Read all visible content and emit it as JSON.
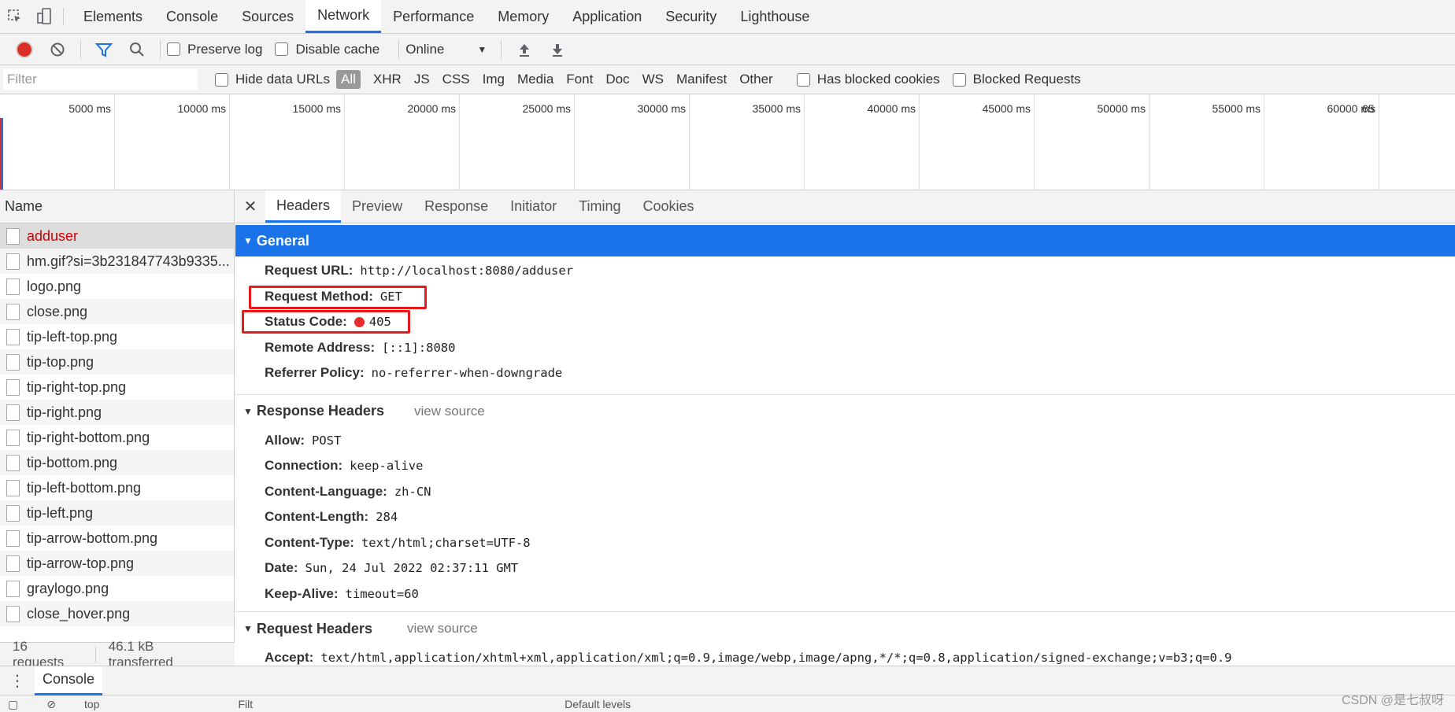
{
  "main_tabs": [
    "Elements",
    "Console",
    "Sources",
    "Network",
    "Performance",
    "Memory",
    "Application",
    "Security",
    "Lighthouse"
  ],
  "toolbar": {
    "preserve_log": "Preserve log",
    "disable_cache": "Disable cache",
    "throttling": "Online"
  },
  "filter": {
    "placeholder": "Filter",
    "hide_data_urls": "Hide data URLs",
    "types": [
      "All",
      "XHR",
      "JS",
      "CSS",
      "Img",
      "Media",
      "Font",
      "Doc",
      "WS",
      "Manifest",
      "Other"
    ],
    "has_blocked_cookies": "Has blocked cookies",
    "blocked_requests": "Blocked Requests"
  },
  "overview": {
    "ticks": [
      "5000 ms",
      "10000 ms",
      "15000 ms",
      "20000 ms",
      "25000 ms",
      "30000 ms",
      "35000 ms",
      "40000 ms",
      "45000 ms",
      "50000 ms",
      "55000 ms",
      "60000 ms",
      "65"
    ]
  },
  "requests": {
    "header": "Name",
    "items": [
      "adduser",
      "hm.gif?si=3b231847743b9335...",
      "logo.png",
      "close.png",
      "tip-left-top.png",
      "tip-top.png",
      "tip-right-top.png",
      "tip-right.png",
      "tip-right-bottom.png",
      "tip-bottom.png",
      "tip-left-bottom.png",
      "tip-left.png",
      "tip-arrow-bottom.png",
      "tip-arrow-top.png",
      "graylogo.png",
      "close_hover.png"
    ],
    "count": "16 requests",
    "transferred": "46.1 kB transferred"
  },
  "detail_tabs": [
    "Headers",
    "Preview",
    "Response",
    "Initiator",
    "Timing",
    "Cookies"
  ],
  "general": {
    "title": "General",
    "rows": [
      {
        "k": "Request URL:",
        "v": "http://localhost:8080/adduser"
      },
      {
        "k": "Request Method:",
        "v": "GET"
      },
      {
        "k": "Status Code:",
        "v": "405"
      },
      {
        "k": "Remote Address:",
        "v": "[::1]:8080"
      },
      {
        "k": "Referrer Policy:",
        "v": "no-referrer-when-downgrade"
      }
    ]
  },
  "response_headers": {
    "title": "Response Headers",
    "view_source": "view source",
    "rows": [
      {
        "k": "Allow:",
        "v": "POST"
      },
      {
        "k": "Connection:",
        "v": "keep-alive"
      },
      {
        "k": "Content-Language:",
        "v": "zh-CN"
      },
      {
        "k": "Content-Length:",
        "v": "284"
      },
      {
        "k": "Content-Type:",
        "v": "text/html;charset=UTF-8"
      },
      {
        "k": "Date:",
        "v": "Sun, 24 Jul 2022 02:37:11 GMT"
      },
      {
        "k": "Keep-Alive:",
        "v": "timeout=60"
      }
    ]
  },
  "request_headers": {
    "title": "Request Headers",
    "view_source": "view source",
    "rows": [
      {
        "k": "Accept:",
        "v": "text/html,application/xhtml+xml,application/xml;q=0.9,image/webp,image/apng,*/*;q=0.8,application/signed-exchange;v=b3;q=0.9"
      }
    ]
  },
  "drawer": {
    "tab": "Console",
    "context": "top",
    "filter": "Filt",
    "levels": "Default levels"
  },
  "watermark": "CSDN @是七叔呀",
  "colors": {
    "accent": "#1a73e8",
    "error": "#c00000",
    "highlight_box": "#e8191b"
  }
}
